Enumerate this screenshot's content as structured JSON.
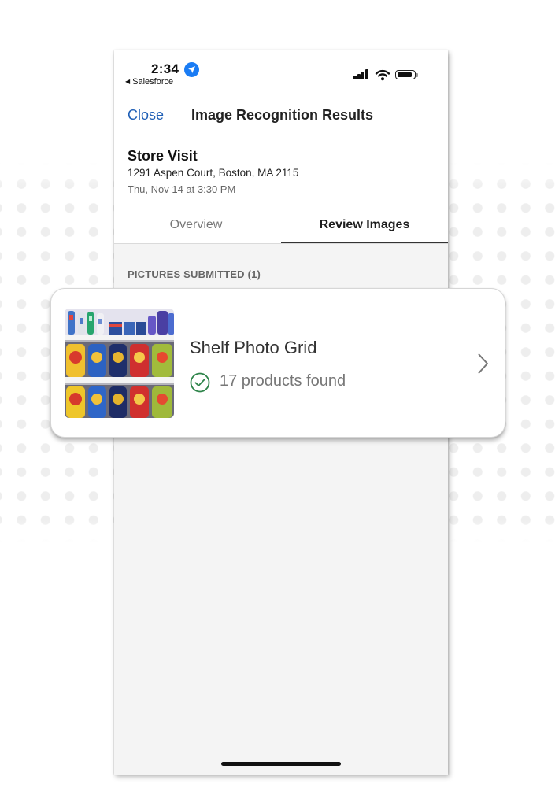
{
  "status_bar": {
    "time": "2:34",
    "back_app": "Salesforce",
    "location_icon": "location-arrow-icon",
    "signal_icon": "cellular-signal-icon",
    "wifi_icon": "wifi-icon",
    "battery_icon": "battery-icon"
  },
  "nav": {
    "close_label": "Close",
    "title": "Image Recognition Results"
  },
  "visit": {
    "title": "Store Visit",
    "address": "1291 Aspen Court, Boston, MA 2115",
    "datetime": "Thu, Nov 14 at  3:30 PM"
  },
  "tabs": [
    {
      "label": "Overview",
      "selected": false
    },
    {
      "label": "Review Images",
      "selected": true
    }
  ],
  "pictures_section": {
    "header": "PICTURES SUBMITTED (1)",
    "items": [
      {
        "title": "Shelf Photo Grid",
        "status": "17 products found",
        "status_icon": "check-circle-icon",
        "thumbnail": "shelf-photo-thumbnail",
        "chevron_icon": "chevron-right-icon"
      }
    ]
  },
  "colors": {
    "link_blue": "#1f5fb6",
    "success_green": "#2e844a",
    "location_blue": "#1a7cf4"
  }
}
